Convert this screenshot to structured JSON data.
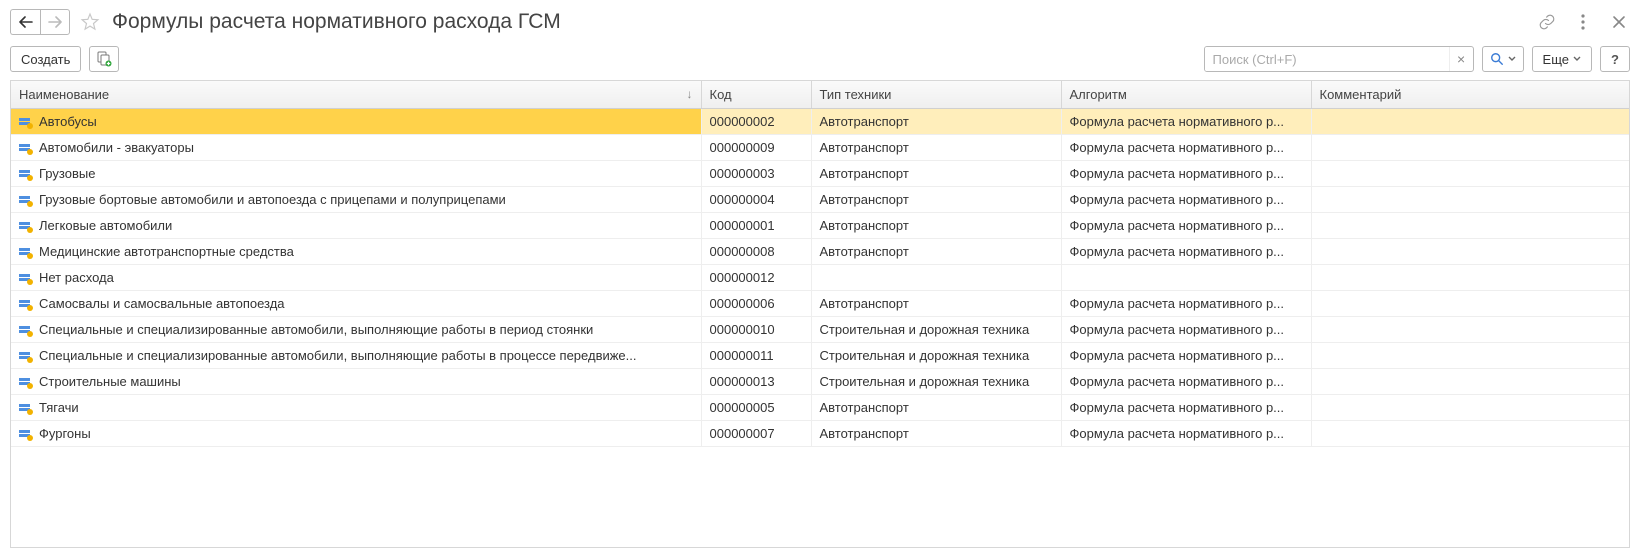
{
  "header": {
    "title": "Формулы расчета нормативного расхода ГСМ"
  },
  "toolbar": {
    "create_label": "Создать",
    "more_label": "Еще"
  },
  "search": {
    "placeholder": "Поиск (Ctrl+F)",
    "value": ""
  },
  "table": {
    "columns": {
      "name": "Наименование",
      "code": "Код",
      "type": "Тип техники",
      "algorithm": "Алгоритм",
      "comment": "Комментарий"
    },
    "rows": [
      {
        "name": "Автобусы",
        "code": "000000002",
        "type": "Автотранспорт",
        "algorithm": "Формула расчета нормативного р...",
        "comment": "",
        "selected": true
      },
      {
        "name": "Автомобили - эвакуаторы",
        "code": "000000009",
        "type": "Автотранспорт",
        "algorithm": "Формула расчета нормативного р...",
        "comment": ""
      },
      {
        "name": "Грузовые",
        "code": "000000003",
        "type": "Автотранспорт",
        "algorithm": "Формула расчета нормативного р...",
        "comment": ""
      },
      {
        "name": "Грузовые бортовые автомобили и автопоезда с прицепами и полуприцепами",
        "code": "000000004",
        "type": "Автотранспорт",
        "algorithm": "Формула расчета нормативного р...",
        "comment": ""
      },
      {
        "name": "Легковые автомобили",
        "code": "000000001",
        "type": "Автотранспорт",
        "algorithm": "Формула расчета нормативного р...",
        "comment": ""
      },
      {
        "name": "Медицинские автотранспортные средства",
        "code": "000000008",
        "type": "Автотранспорт",
        "algorithm": "Формула расчета нормативного р...",
        "comment": ""
      },
      {
        "name": "Нет расхода",
        "code": "000000012",
        "type": "",
        "algorithm": "",
        "comment": ""
      },
      {
        "name": "Самосвалы и самосвальные автопоезда",
        "code": "000000006",
        "type": "Автотранспорт",
        "algorithm": "Формула расчета нормативного р...",
        "comment": ""
      },
      {
        "name": "Специальные и специализированные автомобили, выполняющие работы в период стоянки",
        "code": "000000010",
        "type": "Строительная и дорожная техника",
        "algorithm": "Формула расчета нормативного р...",
        "comment": ""
      },
      {
        "name": "Специальные и специализированные автомобили, выполняющие работы в процессе передвиже...",
        "code": "000000011",
        "type": "Строительная и дорожная техника",
        "algorithm": "Формула расчета нормативного р...",
        "comment": ""
      },
      {
        "name": "Строительные машины",
        "code": "000000013",
        "type": "Строительная и дорожная техника",
        "algorithm": "Формула расчета нормативного р...",
        "comment": ""
      },
      {
        "name": "Тягачи",
        "code": "000000005",
        "type": "Автотранспорт",
        "algorithm": "Формула расчета нормативного р...",
        "comment": ""
      },
      {
        "name": "Фургоны",
        "code": "000000007",
        "type": "Автотранспорт",
        "algorithm": "Формула расчета нормативного р...",
        "comment": ""
      }
    ]
  }
}
